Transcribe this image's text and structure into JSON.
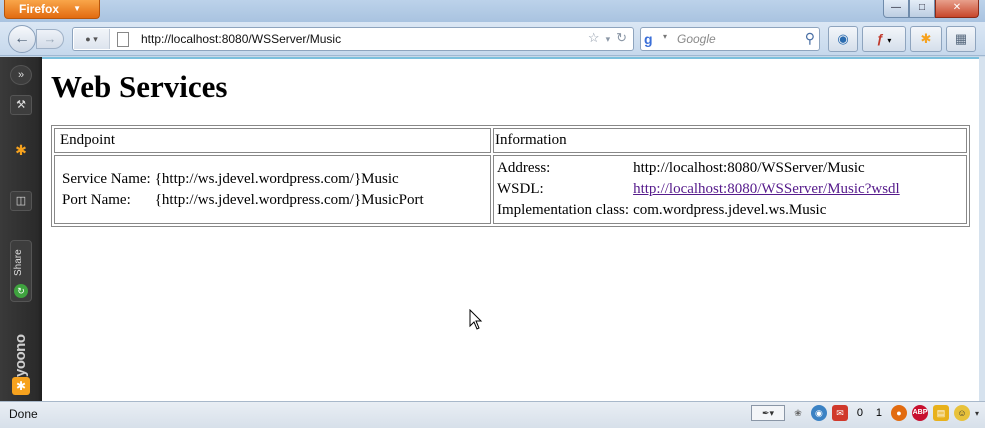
{
  "browser": {
    "menu_button": "Firefox",
    "address": "http://localhost:8080/WSServer/Music",
    "search_placeholder": "Google"
  },
  "sidebar": {
    "share_label": "Share",
    "brand": "yoono"
  },
  "page": {
    "title": "Web Services",
    "table": {
      "headers": [
        "Endpoint",
        "Information"
      ],
      "endpoint": {
        "service_name_label": "Service Name:",
        "service_name_value": "{http://ws.jdevel.wordpress.com/}Music",
        "port_name_label": "Port Name:",
        "port_name_value": "{http://ws.jdevel.wordpress.com/}MusicPort"
      },
      "information": {
        "address_label": "Address:",
        "address_value": "http://localhost:8080/WSServer/Music",
        "wsdl_label": "WSDL:",
        "wsdl_value": "http://localhost:8080/WSServer/Music?wsdl",
        "impl_label": "Implementation class:",
        "impl_value": "com.wordpress.jdevel.ws.Music"
      }
    }
  },
  "statusbar": {
    "text": "Done",
    "count_a": "0",
    "count_b": "1"
  },
  "colors": {
    "link_visited": "#551a8b",
    "firefox_orange": "#e26b10",
    "sidebar_bg": "#2f2f2f"
  }
}
